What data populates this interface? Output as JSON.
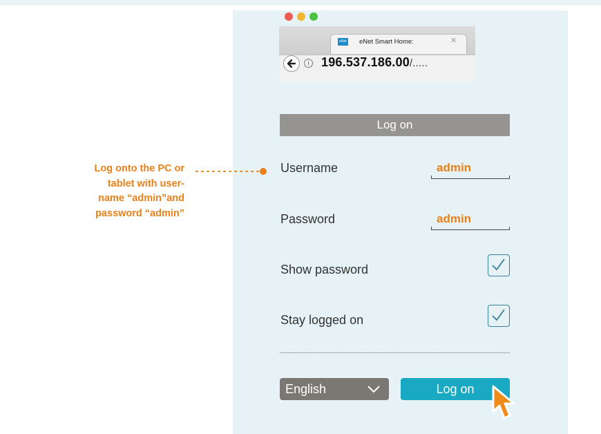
{
  "callout": {
    "line1": "Log onto the PC or",
    "line2": "tablet with user-",
    "line3": "name “admin”and",
    "line4": "password “admin”"
  },
  "browser": {
    "tab_icon_text": "eNet",
    "tab_title": "eNet Smart Home:",
    "url_host": "196.537.186.00",
    "url_path": "/....."
  },
  "form": {
    "header": "Log on",
    "username_label": "Username",
    "username_value": "admin",
    "password_label": "Password",
    "password_value": "admin",
    "show_password_label": "Show password",
    "show_password_checked": true,
    "stay_logged_label": "Stay logged on",
    "stay_logged_checked": true,
    "language_selected": "English",
    "login_button": "Log on"
  },
  "colors": {
    "accent_orange": "#e8811a",
    "login_button": "#19a9c2",
    "panel_bg": "#e6f2f6",
    "header_bar": "#969491",
    "select_bg": "#7b7773"
  },
  "icons": [
    "back-arrow-icon",
    "info-icon",
    "close-tab-icon",
    "checkmark-icon",
    "chevron-down-icon",
    "mouse-cursor-icon"
  ]
}
